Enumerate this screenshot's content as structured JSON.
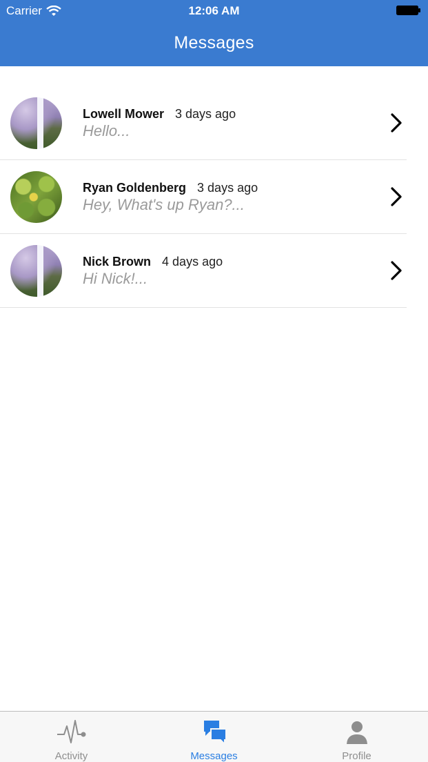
{
  "status_bar": {
    "carrier": "Carrier",
    "time": "12:06 AM"
  },
  "nav": {
    "title": "Messages"
  },
  "conversations": [
    {
      "name": "Lowell Mower",
      "time": "3 days ago",
      "preview": "Hello...",
      "avatar": "waterfall-photo"
    },
    {
      "name": "Ryan Goldenberg",
      "time": "3 days ago",
      "preview": "Hey, What's up Ryan?...",
      "avatar": "leaves-photo"
    },
    {
      "name": "Nick Brown",
      "time": "4 days ago",
      "preview": "Hi Nick!...",
      "avatar": "waterfall-photo"
    }
  ],
  "tabs": [
    {
      "label": "Activity",
      "icon": "activity-icon",
      "active": false
    },
    {
      "label": "Messages",
      "icon": "messages-icon",
      "active": true
    },
    {
      "label": "Profile",
      "icon": "profile-icon",
      "active": false
    }
  ],
  "colors": {
    "header": "#3a7bd0",
    "active_tab": "#2a7ee2",
    "inactive_tab": "#8e8e8e",
    "preview_text": "#9a9a9a"
  }
}
